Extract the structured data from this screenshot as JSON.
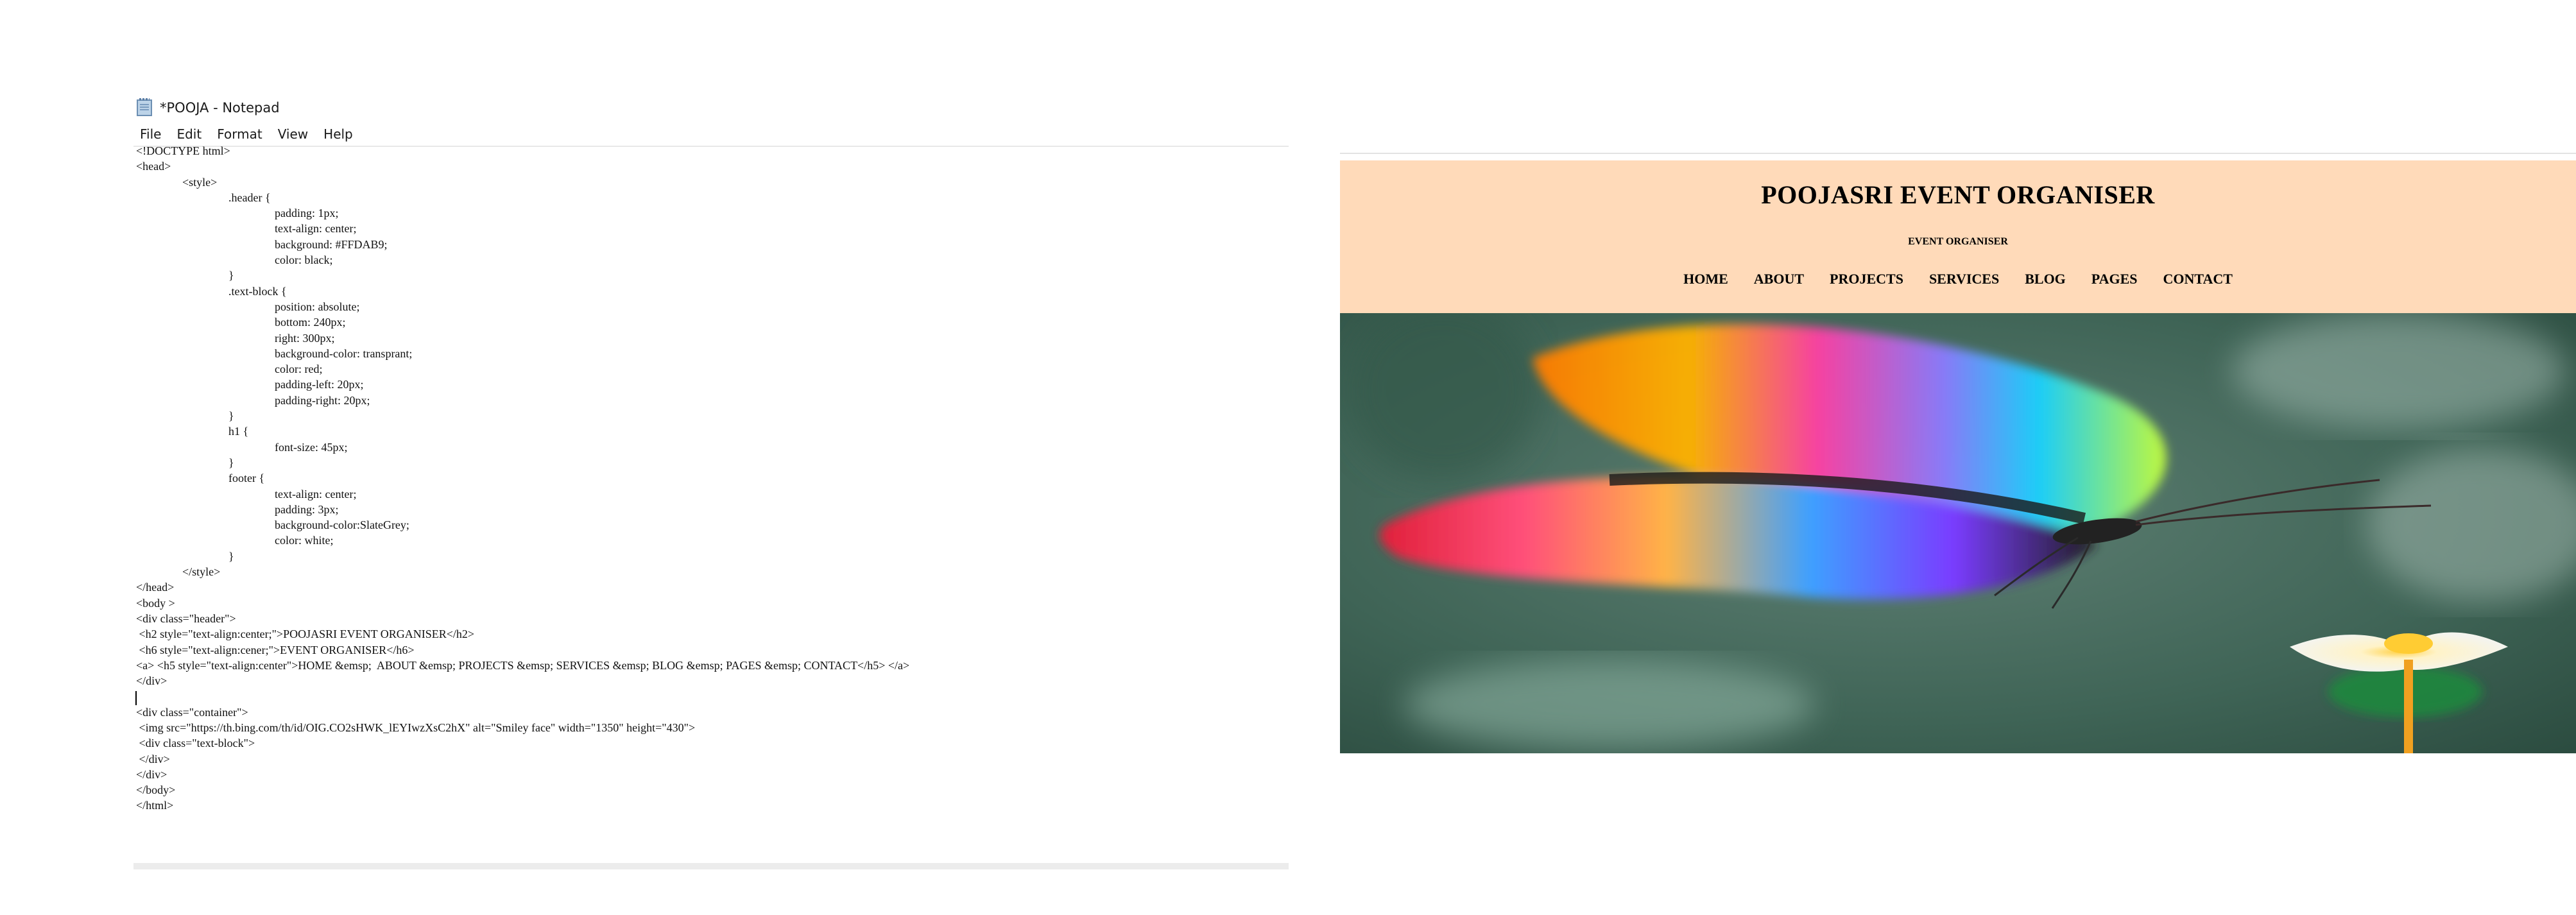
{
  "notepad": {
    "title": "*POOJA - Notepad",
    "menu": [
      "File",
      "Edit",
      "Format",
      "View",
      "Help"
    ],
    "lines": [
      "<!DOCTYPE html>",
      "<head>",
      "\t\t<style>",
      "\t\t\t\t.header {",
      "\t\t\t\t\t\tpadding: 1px;",
      "\t\t\t\t\t\ttext-align: center;",
      "\t\t\t\t\t\tbackground: #FFDAB9;",
      "\t\t\t\t\t\tcolor: black;",
      "\t\t\t\t}",
      "\t\t\t\t.text-block {",
      "\t\t\t\t\t\tposition: absolute;",
      "\t\t\t\t\t\tbottom: 240px;",
      "\t\t\t\t\t\tright: 300px;",
      "\t\t\t\t\t\tbackground-color: transprant;",
      "\t\t\t\t\t\tcolor: red;",
      "\t\t\t\t\t\tpadding-left: 20px;",
      "\t\t\t\t\t\tpadding-right: 20px;",
      "\t\t\t\t}",
      "\t\t\t\th1 {",
      "\t\t\t\t\t\tfont-size: 45px;",
      "\t\t\t\t}",
      "\t\t\t\tfooter {",
      "\t\t\t\t\t\ttext-align: center;",
      "\t\t\t\t\t\tpadding: 3px;",
      "\t\t\t\t\t\tbackground-color:SlateGrey;",
      "\t\t\t\t\t\tcolor: white;",
      "\t\t\t\t}",
      "\t\t</style>",
      "</head>",
      "<body >",
      "<div class=\"header\">",
      " <h2 style=\"text-align:center;\">POOJASRI EVENT ORGANISER</h2>",
      " <h6 style=\"text-align:cener;\">EVENT ORGANISER</h6>",
      "<a> <h5 style=\"text-align:center\">HOME &emsp;  ABOUT &emsp; PROJECTS &emsp; SERVICES &emsp; BLOG &emsp; PAGES &emsp; CONTACT</h5> </a>",
      "</div>",
      "",
      "<div class=\"container\">",
      " <img src=\"https://th.bing.com/th/id/OIG.CO2sHWK_lEYIwzXsC2hX\" alt=\"Smiley face\" width=\"1350\" height=\"430\">",
      " <div class=\"text-block\">",
      " </div>",
      "</div>",
      "</body>",
      "</html>"
    ]
  },
  "preview": {
    "title": "POOJASRI EVENT ORGANISER",
    "subtitle": "EVENT ORGANISER",
    "nav": [
      "HOME",
      "ABOUT",
      "PROJECTS",
      "SERVICES",
      "BLOG",
      "PAGES",
      "CONTACT"
    ],
    "header_background": "#FFDAB9",
    "image_subject": "butterfly-image"
  }
}
